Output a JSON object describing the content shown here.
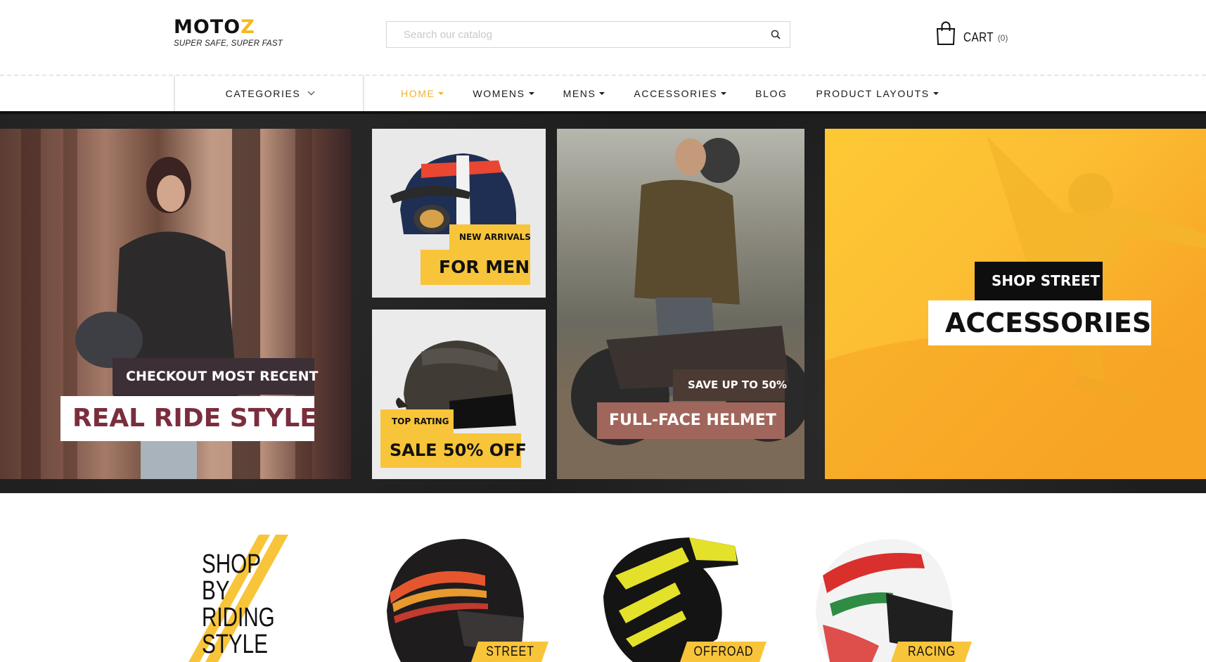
{
  "header": {
    "logo_text": "MOTO",
    "logo_slash": "Z",
    "tagline": "SUPER SAFE, SUPER FAST",
    "search_placeholder": "Search our catalog",
    "cart_label": "CART",
    "cart_count": "(0)"
  },
  "nav": {
    "categories_label": "CATEGORIES",
    "items": [
      {
        "label": "HOME",
        "active": true
      },
      {
        "label": "WOMENS"
      },
      {
        "label": "MENS"
      },
      {
        "label": "ACCESSORIES"
      },
      {
        "label": "BLOG"
      },
      {
        "label": "PRODUCT LAYOUTS"
      }
    ]
  },
  "banners": {
    "b1": {
      "top": "CHECKOUT MOST RECENT",
      "main": "REAL RIDE STYLE"
    },
    "b2": {
      "top": "NEW ARRIVALS",
      "main": "FOR MEN"
    },
    "b3": {
      "top": "TOP RATING",
      "main": "SALE 50% OFF"
    },
    "b4": {
      "top": "SAVE UP TO 50%",
      "main": "FULL-FACE HELMET"
    },
    "b5": {
      "top": "SHOP STREET",
      "main": "ACCESSORIES"
    }
  },
  "riding": {
    "lines": [
      "SHOP",
      "BY",
      "RIDING",
      "STYLE"
    ],
    "products": [
      {
        "label": "STREET"
      },
      {
        "label": "OFFROAD"
      },
      {
        "label": "RACING"
      }
    ]
  },
  "colors": {
    "accent": "#f8c43a",
    "nav_active": "#f3b32b",
    "dark": "#111111"
  }
}
